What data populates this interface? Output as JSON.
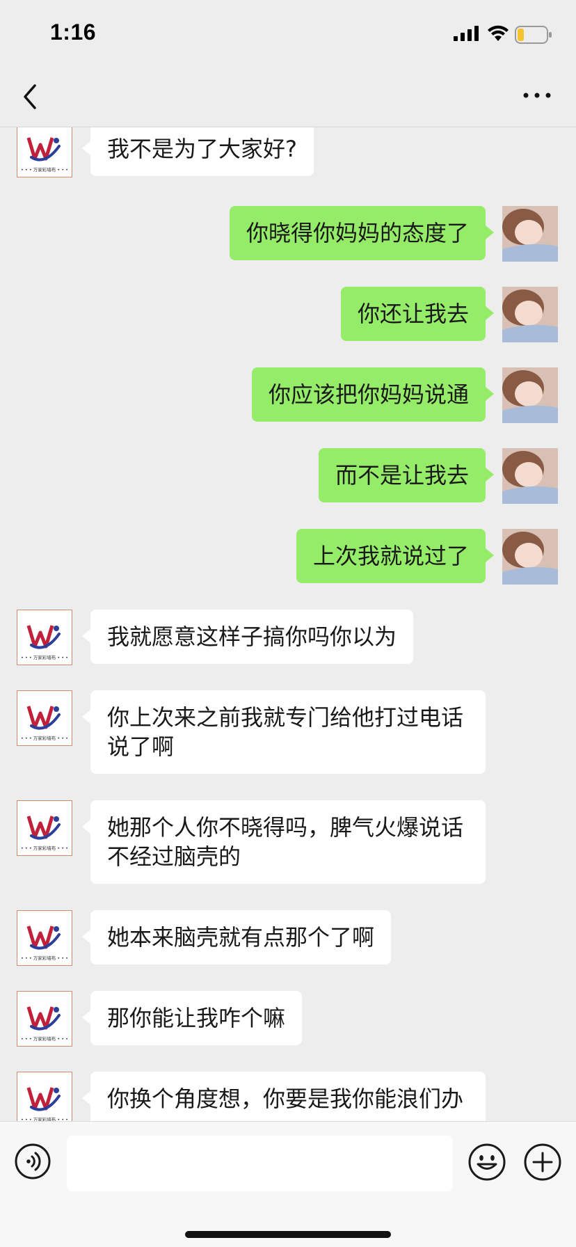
{
  "status_bar": {
    "time": "1:16",
    "battery_color": "#f4c430"
  },
  "nav": {
    "back_icon": "chevron-left-icon",
    "more_icon": "more-dots-icon"
  },
  "theme": {
    "self_bubble": "#95ec69",
    "other_bubble": "#ffffff",
    "background": "#ededed"
  },
  "contact_avatar": {
    "logo_caption": "• • • 万家彩墙布 • • •",
    "logo_colors": [
      "#c0203a",
      "#2a3f9a"
    ]
  },
  "messages": [
    {
      "from": "other",
      "text": "我不是为了大家好?"
    },
    {
      "from": "self",
      "text": "你晓得你妈妈的态度了"
    },
    {
      "from": "self",
      "text": "你还让我去"
    },
    {
      "from": "self",
      "text": "你应该把你妈妈说通"
    },
    {
      "from": "self",
      "text": "而不是让我去"
    },
    {
      "from": "self",
      "text": "上次我就说过了"
    },
    {
      "from": "other",
      "text": "我就愿意这样子搞你吗你以为"
    },
    {
      "from": "other",
      "text": "你上次来之前我就专门给他打过电话说了啊"
    },
    {
      "from": "other",
      "text": "她那个人你不晓得吗，脾气火爆说话不经过脑壳的"
    },
    {
      "from": "other",
      "text": "她本来脑壳就有点那个了啊"
    },
    {
      "from": "other",
      "text": "那你能让我咋个嘛"
    },
    {
      "from": "other",
      "text": "你换个角度想，你要是我你能浪们办"
    }
  ],
  "input_bar": {
    "text_value": "",
    "voice_icon": "voice-icon",
    "emoji_icon": "emoji-icon",
    "plus_icon": "plus-icon"
  }
}
